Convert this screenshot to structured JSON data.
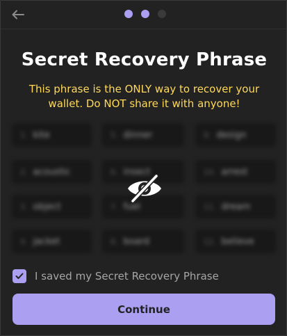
{
  "header": {
    "back_icon": "arrow-left-icon",
    "steps": [
      {
        "state": "done",
        "color": "#ab9ff2"
      },
      {
        "state": "active",
        "color": "#ab9ff2"
      },
      {
        "state": "upcoming",
        "color": "#3a3a3a"
      }
    ]
  },
  "title": "Secret Recovery Phrase",
  "warning": "This phrase is the ONLY way to recover your wallet. Do NOT share it with anyone!",
  "phrase": {
    "hidden": true,
    "toggle_icon": "eye-off-icon",
    "words": [
      {
        "num": "1.",
        "word": "kite"
      },
      {
        "num": "5.",
        "word": "dinner"
      },
      {
        "num": "9.",
        "word": "design"
      },
      {
        "num": "2.",
        "word": "acoustic"
      },
      {
        "num": "6.",
        "word": "insect"
      },
      {
        "num": "10.",
        "word": "arrest"
      },
      {
        "num": "3.",
        "word": "object"
      },
      {
        "num": "7.",
        "word": "fuel"
      },
      {
        "num": "11.",
        "word": "dream"
      },
      {
        "num": "4.",
        "word": "jacket"
      },
      {
        "num": "8.",
        "word": "board"
      },
      {
        "num": "12.",
        "word": "believe"
      }
    ]
  },
  "confirm": {
    "checked": true,
    "label": "I saved my Secret Recovery Phrase"
  },
  "continue_label": "Continue",
  "colors": {
    "accent": "#ab9ff2",
    "warning": "#ffd95a",
    "background": "#222222"
  }
}
